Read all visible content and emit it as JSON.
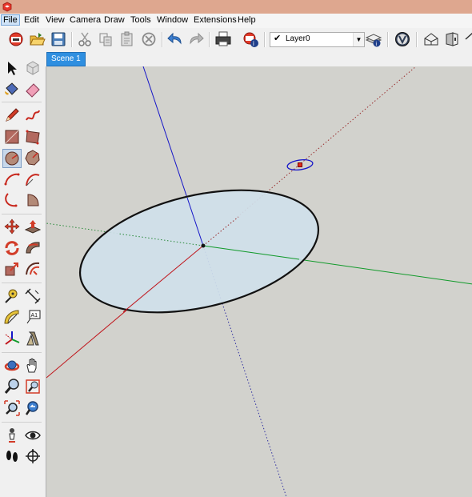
{
  "menu": {
    "file": "File",
    "edit": "Edit",
    "view": "View",
    "camera": "Camera",
    "draw": "Draw",
    "tools": "Tools",
    "window": "Window",
    "extensions": "Extensions",
    "help": "Help"
  },
  "layer": {
    "name": "Layer0"
  },
  "scene": {
    "tab": "Scene 1"
  },
  "colors": {
    "viewport_bg": "#d2d2cd",
    "ellipse_fill": "#cfe0ea",
    "axis_red": "#c0171d",
    "axis_green": "#119a2a",
    "axis_blue": "#1616c8",
    "scene_tab": "#2f8fe0"
  },
  "toolbar_icons": [
    "new-model-icon",
    "open-icon",
    "save-icon",
    "cut-icon",
    "copy-icon",
    "paste-icon",
    "erase-icon",
    "undo-icon",
    "redo-icon",
    "print-icon",
    "model-info-icon",
    "layer-visible-icon",
    "layer-manager-icon",
    "view-extension-icon",
    "iso-view-icon",
    "front-view-icon",
    "home-view-icon"
  ],
  "left_tool_icons": [
    "select-icon",
    "component-icon",
    "paint-bucket-icon",
    "eraser-icon",
    "pencil-icon",
    "freehand-icon",
    "rectangle-icon",
    "rotated-rectangle-icon",
    "circle-icon",
    "polygon-icon",
    "arc-icon",
    "two-point-arc-icon",
    "three-point-arc-icon",
    "pie-icon",
    "move-icon",
    "push-pull-icon",
    "rotate-icon",
    "follow-me-icon",
    "scale-icon",
    "offset-icon",
    "tape-measure-icon",
    "dimension-icon",
    "protractor-icon",
    "text-icon",
    "axes-icon",
    "3d-text-icon",
    "orbit-icon",
    "pan-icon",
    "zoom-icon",
    "zoom-window-icon",
    "zoom-extents-icon",
    "previous-view-icon",
    "position-camera-icon",
    "look-around-icon",
    "walk-icon",
    "section-plane-icon"
  ]
}
